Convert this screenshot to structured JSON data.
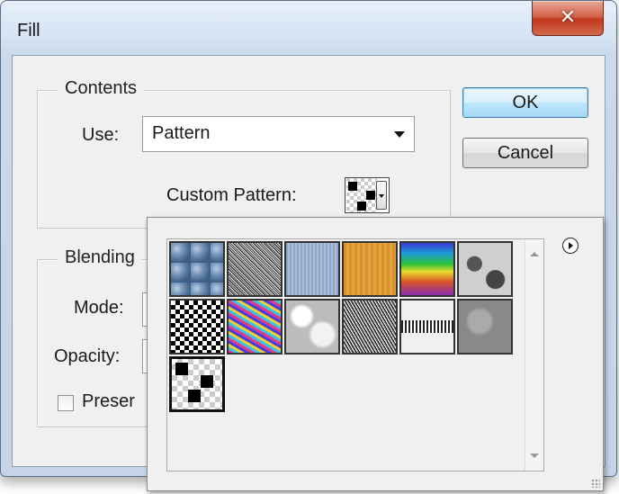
{
  "window": {
    "title": "Fill",
    "close_glyph": "✕"
  },
  "contents": {
    "legend": "Contents",
    "use_label": "Use:",
    "use_value": "Pattern",
    "custom_pattern_label": "Custom Pattern:"
  },
  "blending": {
    "legend": "Blending",
    "mode_label": "Mode:",
    "opacity_label": "Opacity:",
    "preserve_label": "Preser"
  },
  "buttons": {
    "ok": "OK",
    "cancel": "Cancel"
  },
  "pattern_picker": {
    "selected_index": 12,
    "patterns": [
      "bubbles",
      "noise-gray",
      "blue-weave",
      "orange-wood",
      "rainbow-stripes",
      "gray-stone",
      "checker-bw",
      "colorful-confetti",
      "clouds",
      "gray-noise",
      "stripe-pattern",
      "gray-granite",
      "custom-checker"
    ]
  },
  "icons": {
    "pattern_menu": "flyout-menu-icon",
    "scroll_up": "scroll-up-icon",
    "scroll_down": "scroll-down-icon"
  }
}
